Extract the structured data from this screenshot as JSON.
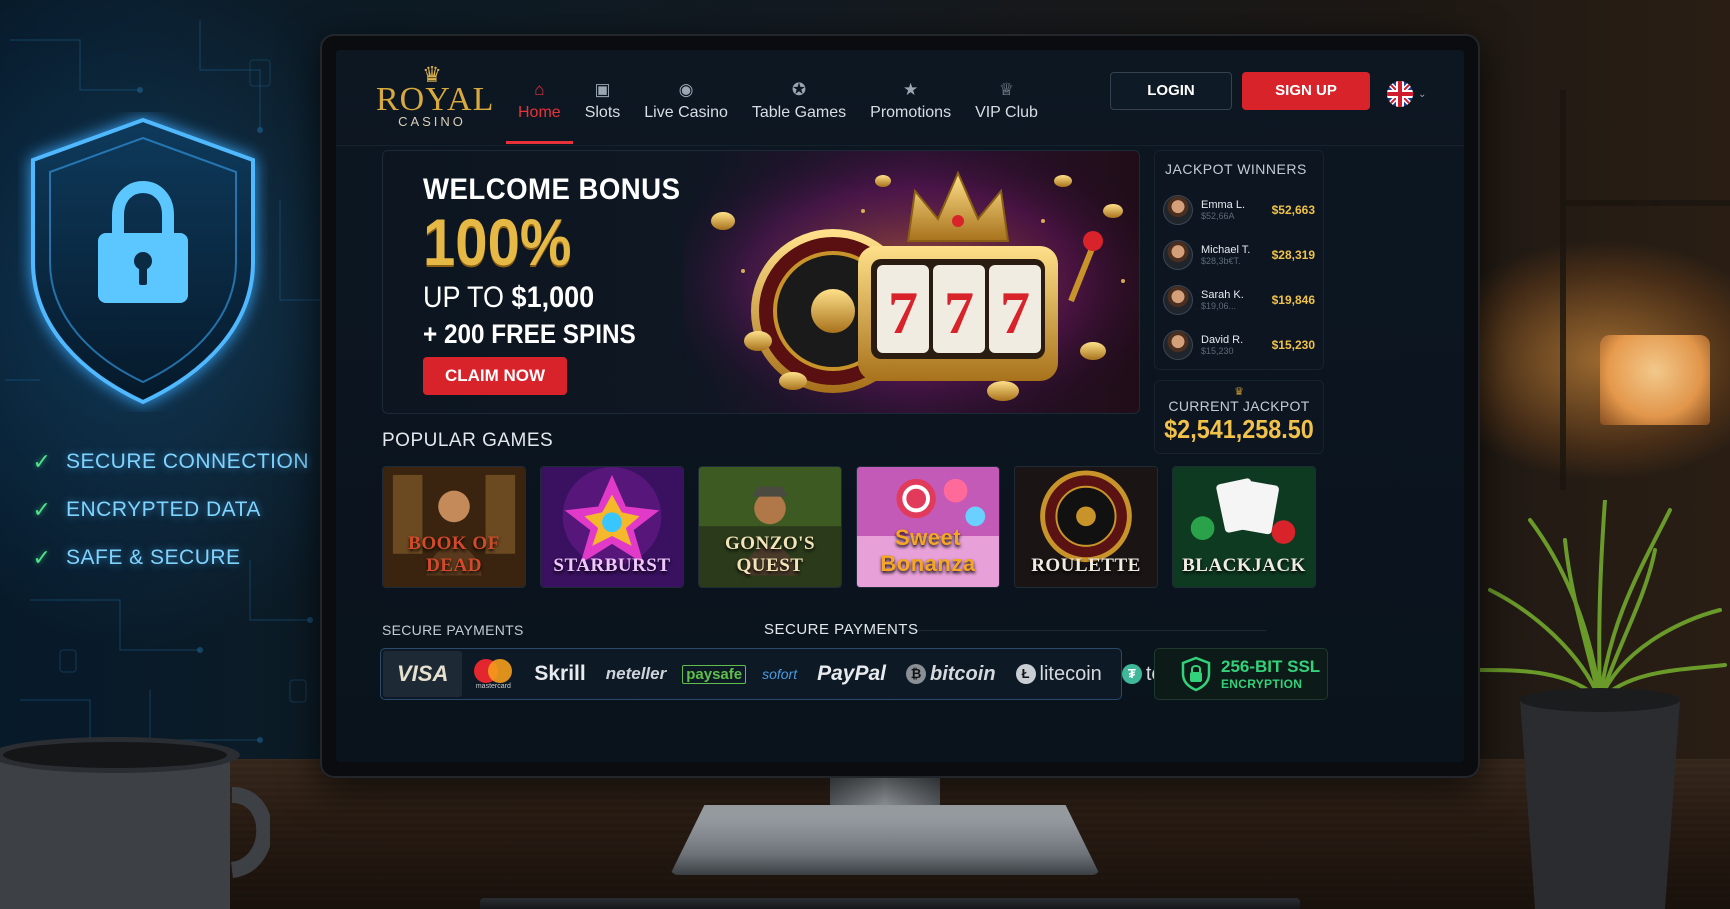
{
  "security": {
    "features": [
      "SECURE CONNECTION",
      "ENCRYPTED DATA",
      "SAFE & SECURE"
    ]
  },
  "brand": {
    "name": "ROYAL",
    "sub": "CASINO"
  },
  "nav": {
    "items": [
      {
        "label": "Home",
        "icon": "home-icon",
        "active": true
      },
      {
        "label": "Slots",
        "icon": "slots-icon",
        "active": false
      },
      {
        "label": "Live Casino",
        "icon": "live-casino-icon",
        "active": false
      },
      {
        "label": "Table Games",
        "icon": "table-games-icon",
        "active": false
      },
      {
        "label": "Promotions",
        "icon": "promotions-icon",
        "active": false
      },
      {
        "label": "VIP Club",
        "icon": "vip-icon",
        "active": false
      }
    ],
    "login": "LOGIN",
    "signup": "SIGN UP",
    "language_icon": "uk-flag-icon"
  },
  "hero": {
    "title": "WELCOME BONUS",
    "percent": "100%",
    "upto_prefix": "UP TO",
    "upto_amount": "$1,000",
    "spins": "+ 200 FREE SPINS",
    "cta": "CLAIM NOW"
  },
  "jackpot": {
    "title": "JACKPOT WINNERS",
    "winners": [
      {
        "name": "Emma L.",
        "sub": "$52,66A",
        "amount": "$52,663"
      },
      {
        "name": "Michael T.",
        "sub": "$28,3b€T.",
        "amount": "$28,319"
      },
      {
        "name": "Sarah K.",
        "sub": "$19,06...",
        "amount": "$19,846"
      },
      {
        "name": "David R.",
        "sub": "$15,230",
        "amount": "$15,230"
      }
    ],
    "current_label": "CURRENT JACKPOT",
    "current_amount": "$2,541,258.50"
  },
  "games": {
    "title": "POPULAR GAMES",
    "items": [
      {
        "name": "BOOK OF DEAD",
        "color": "#d24a2a"
      },
      {
        "name": "STARBURST",
        "color": "#f0c6ff"
      },
      {
        "name": "GONZO'S QUEST",
        "color": "#f2e3b8"
      },
      {
        "name": "Sweet Bonanza",
        "color": "#f5a623"
      },
      {
        "name": "ROULETTE",
        "color": "#f1ece2"
      },
      {
        "name": "BLACKJACK",
        "color": "#f1ece2"
      }
    ]
  },
  "payments": {
    "label_left": "SECURE PAYMENTS",
    "label_center": "SECURE PAYMENTS",
    "methods": {
      "visa": "VISA",
      "mastercard": "mastercard",
      "skrill": "Skrill",
      "neteller": "neteller",
      "paysafe": "paysafe",
      "skrill2": "sofort",
      "paypal": "PayPal",
      "bitcoin": "bitcoin",
      "litecoin": "litecoin",
      "tether": "tether"
    },
    "ssl_title": "256-BIT SSL",
    "ssl_sub": "ENCRYPTION"
  },
  "colors": {
    "accent": "#d9232b",
    "gold": "#f0c24a",
    "secure_green": "#33d17a",
    "feature_blue": "#7fd4ff"
  }
}
